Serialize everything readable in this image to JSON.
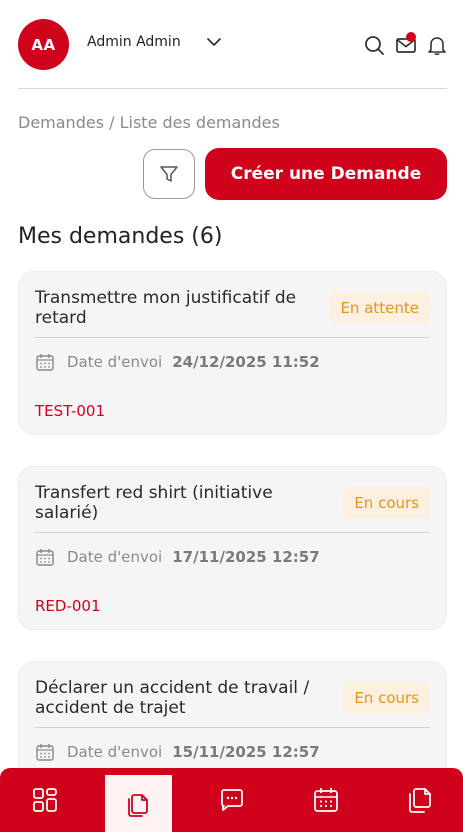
{
  "header": {
    "avatar_initials": "AA",
    "user_name": "Admin Admin",
    "icons": [
      "chevron-down-icon",
      "search-icon",
      "mail-icon",
      "bell-icon"
    ],
    "notification_dot": true
  },
  "breadcrumb": "Demandes / Liste des demandes",
  "actions": {
    "filter_icon": "filter-icon",
    "create_label": "Créer une Demande"
  },
  "section_title": "Mes demandes (6)",
  "requests": [
    {
      "title": "Transmettre mon justificatif de retard",
      "status": "En attente",
      "date_label": "Date d'envoi",
      "date_value": "24/12/2025 11:52",
      "reference": "TEST-001"
    },
    {
      "title": "Transfert red shirt (initiative salarié)",
      "status": "En cours",
      "date_label": "Date d'envoi",
      "date_value": "17/11/2025 12:57",
      "reference": "RED-001"
    },
    {
      "title": "Déclarer un accident de travail / accident de trajet",
      "status": "En cours",
      "date_label": "Date d'envoi",
      "date_value": "15/11/2025 12:57",
      "reference": ""
    }
  ],
  "bottom_nav": {
    "items": [
      "dashboard-icon",
      "documents-icon",
      "messages-icon",
      "calendar-icon",
      "files-icon"
    ],
    "active": "documents-icon"
  },
  "colors": {
    "brand": "#d0021b",
    "badge_bg": "#fdf0e0",
    "badge_text": "#e9931f"
  }
}
